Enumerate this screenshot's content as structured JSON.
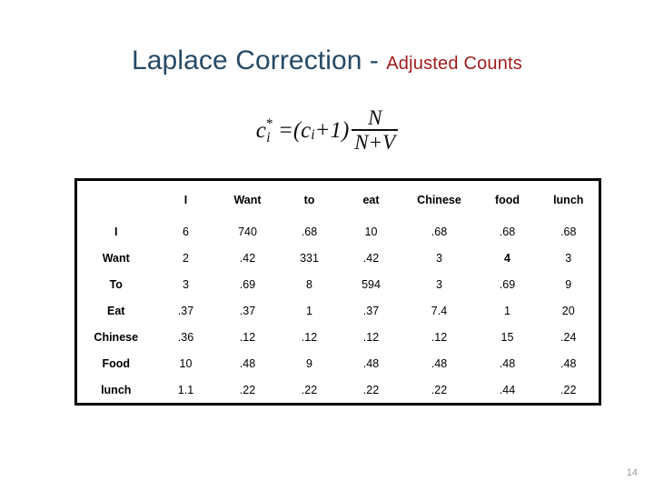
{
  "title": {
    "main": "Laplace Correction",
    "dash": " - ",
    "sub": "Adjusted Counts",
    "main_color": "#254A66",
    "sub_color": "#9E1B1B"
  },
  "formula": {
    "lhs_var": "c",
    "lhs_sup": "*",
    "lhs_sub": "i",
    "equals": "=",
    "open_paren": "(",
    "rhs_var": "c",
    "rhs_sub": "i",
    "plus_one": "+1",
    "close_paren": ")",
    "fraction_numerator": "N",
    "fraction_denominator": "N+V",
    "plain_text": "c*_i = (c_i + 1) N/(N+V)"
  },
  "table": {
    "corner_label": "",
    "columns": [
      "I",
      "Want",
      "to",
      "eat",
      "Chinese",
      "food",
      "lunch"
    ],
    "rows": [
      {
        "label": "I",
        "values": [
          "6",
          "740",
          ".68",
          "10",
          ".68",
          ".68",
          ".68"
        ]
      },
      {
        "label": "Want",
        "values": [
          "2",
          ".42",
          "331",
          ".42",
          "3",
          "4",
          "3"
        ]
      },
      {
        "label": "To",
        "values": [
          "3",
          ".69",
          "8",
          "594",
          "3",
          ".69",
          "9"
        ]
      },
      {
        "label": "Eat",
        "values": [
          ".37",
          ".37",
          "1",
          ".37",
          "7.4",
          "1",
          "20"
        ]
      },
      {
        "label": "Chinese",
        "values": [
          ".36",
          ".12",
          ".12",
          ".12",
          ".12",
          "15",
          ".24"
        ]
      },
      {
        "label": "Food",
        "values": [
          "10",
          ".48",
          "9",
          ".48",
          ".48",
          ".48",
          ".48"
        ]
      },
      {
        "label": "lunch",
        "values": [
          "1.1",
          ".22",
          ".22",
          ".22",
          ".22",
          ".44",
          ".22"
        ]
      }
    ]
  },
  "page_number": "14"
}
